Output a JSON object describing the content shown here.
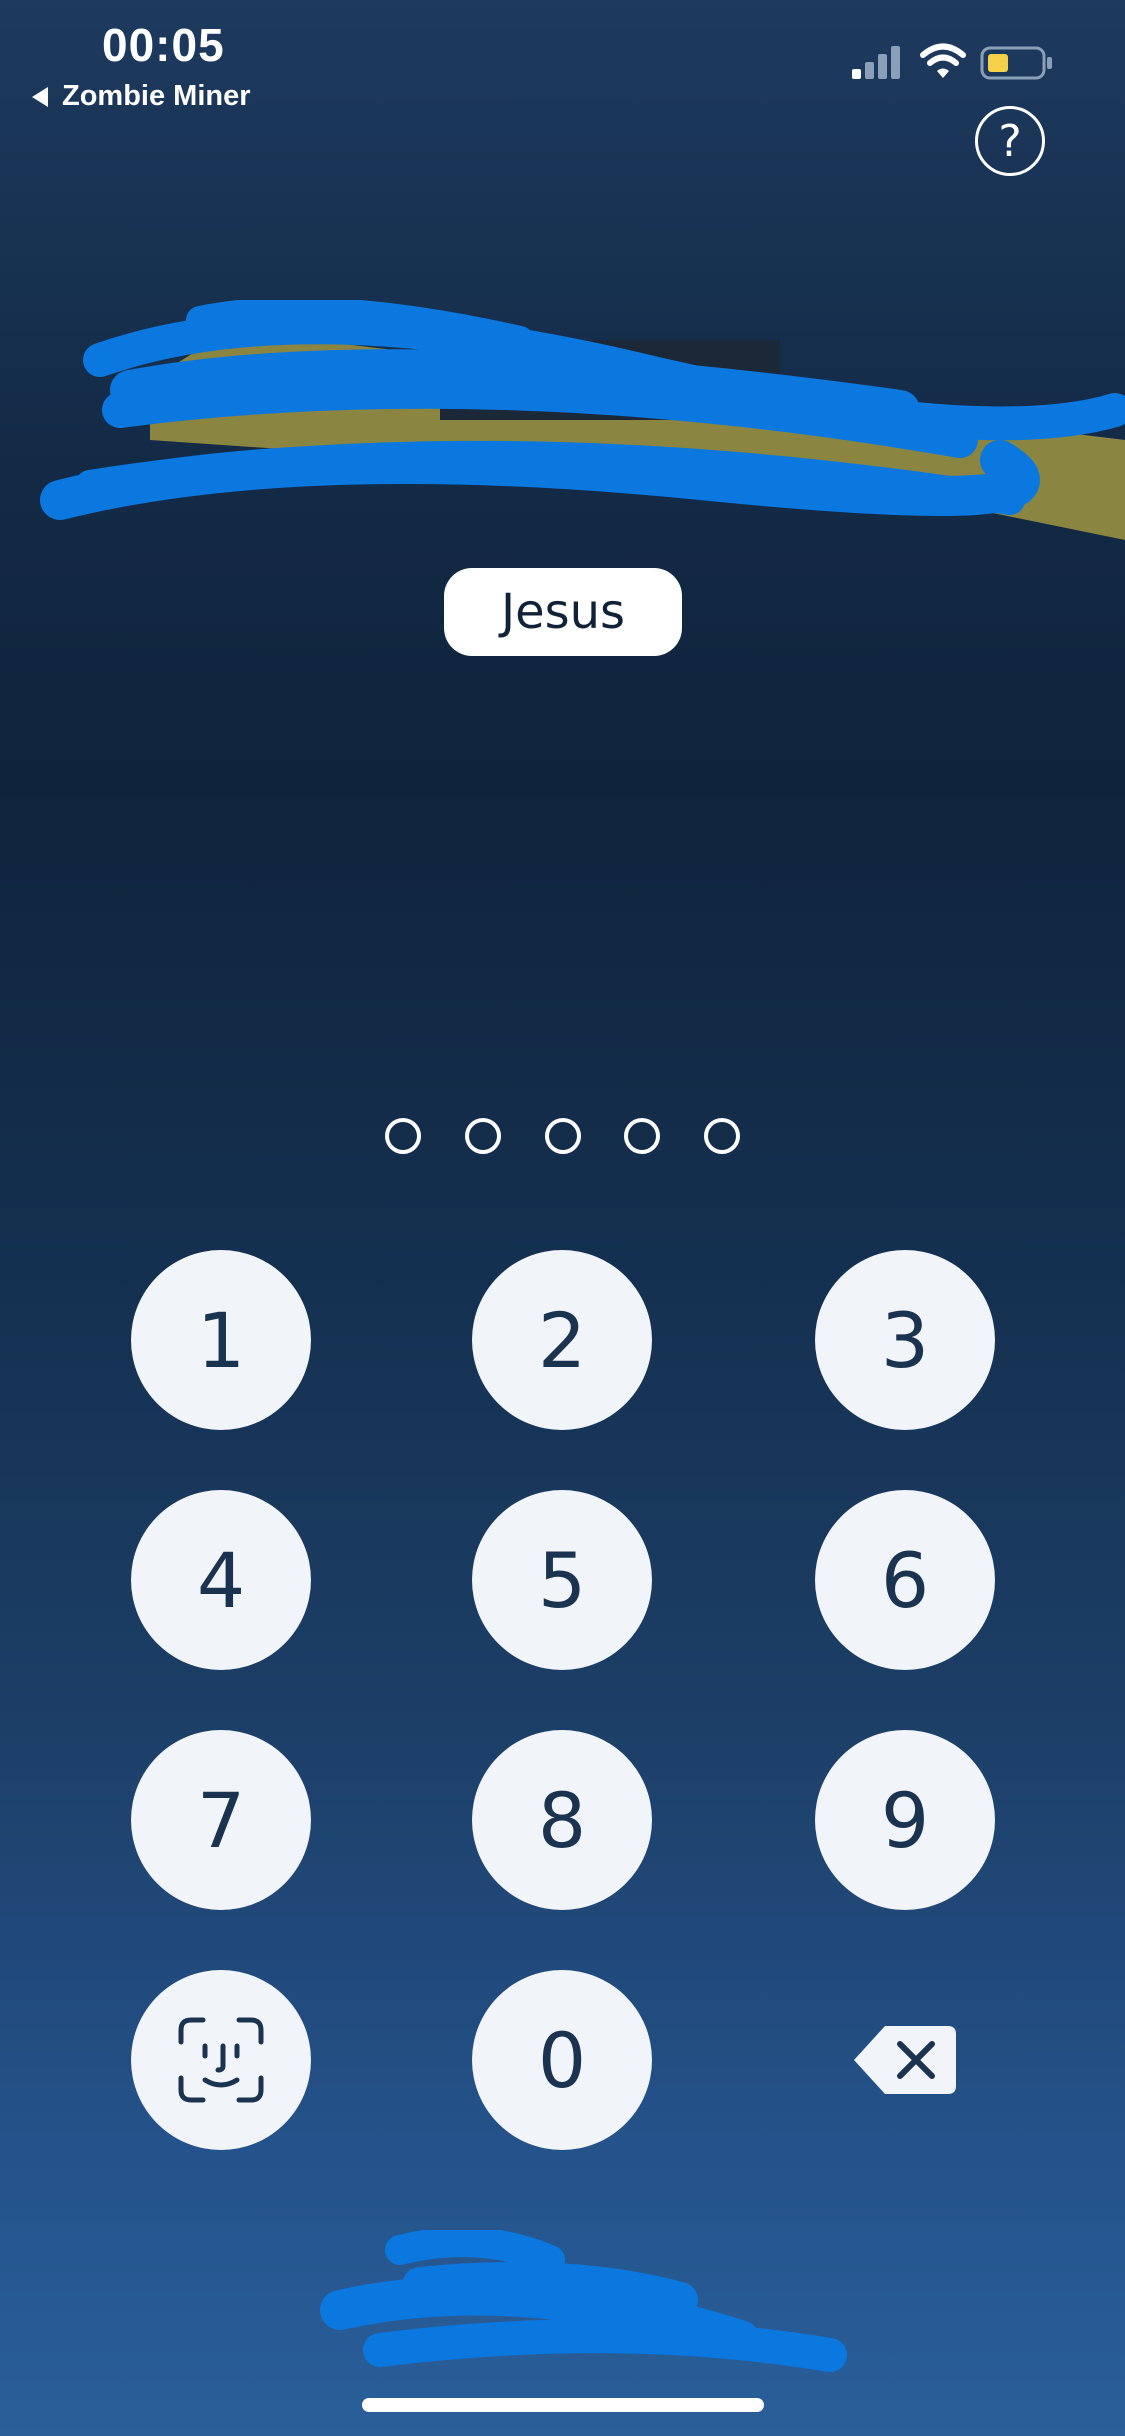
{
  "status_bar": {
    "time": "00:05",
    "back_app_label": "Zombie Miner",
    "icons": [
      "signal-icon",
      "wifi-icon",
      "battery-icon"
    ],
    "battery_fill_color": "#f5d14a"
  },
  "header": {
    "help_icon_glyph": "?"
  },
  "user": {
    "name": "Jesus"
  },
  "pin": {
    "length": 5,
    "entered": 0
  },
  "keypad": {
    "keys": [
      "1",
      "2",
      "3",
      "4",
      "5",
      "6",
      "7",
      "8",
      "9",
      "0"
    ],
    "biometric_icon": "face-id-icon",
    "delete_icon": "backspace-icon"
  },
  "colors": {
    "redaction_scribble": "#0a78de",
    "banner_olive": "#8a8540",
    "key_background": "#f1f4f8",
    "key_text": "#1a3350"
  }
}
